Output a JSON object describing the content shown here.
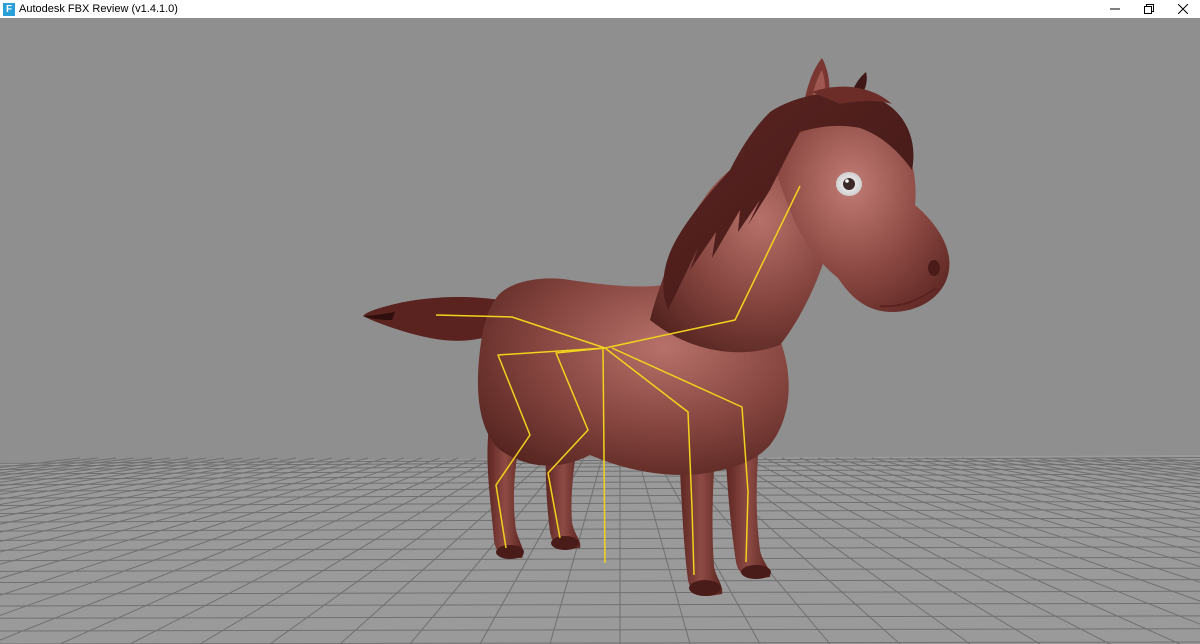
{
  "window": {
    "title": "Autodesk FBX Review (v1.4.1.0)",
    "app_icon": "fbx-review-icon",
    "app_icon_glyph": "F",
    "controls": [
      {
        "name": "minimize-button",
        "icon": "minimize-icon"
      },
      {
        "name": "maximize-button",
        "icon": "restore-icon"
      },
      {
        "name": "close-button",
        "icon": "close-icon"
      }
    ]
  },
  "viewport": {
    "background_color": "#8f8f8f",
    "grid_color": "#6e6e6e",
    "floor_color": "#9c9c9c",
    "model": "horse",
    "model_color": "#7a3a34",
    "skeleton_color": "#f2d21c"
  }
}
